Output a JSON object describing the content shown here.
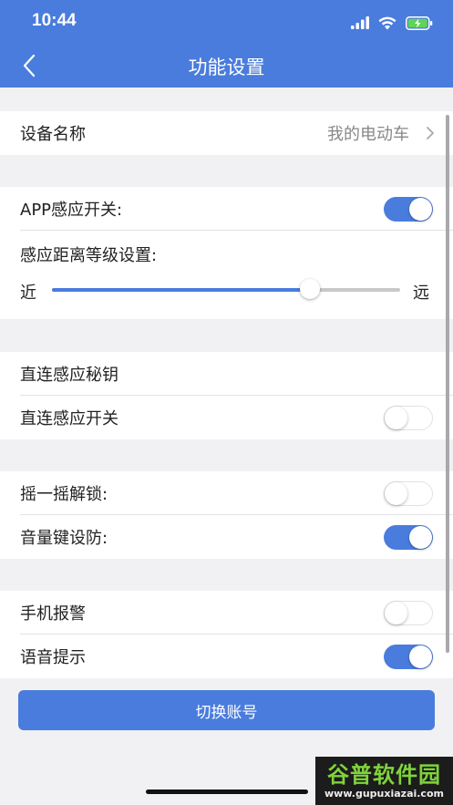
{
  "status": {
    "time": "10:44"
  },
  "header": {
    "title": "功能设置"
  },
  "device": {
    "label": "设备名称",
    "value": "我的电动车"
  },
  "sensing": {
    "app_switch_label": "APP感应开关:",
    "app_switch_on": true,
    "distance_label": "感应距离等级设置:",
    "slider_min_label": "近",
    "slider_max_label": "远",
    "slider_value_fraction": 0.74
  },
  "direct": {
    "key_label": "直连感应秘钥",
    "switch_label": "直连感应开关",
    "switch_on": false
  },
  "controls": {
    "shake_label": "摇一摇解锁:",
    "shake_on": false,
    "volume_label": "音量键设防:",
    "volume_on": true
  },
  "alerts": {
    "alarm_label": "手机报警",
    "alarm_on": false,
    "voice_label": "语音提示",
    "voice_on": true
  },
  "switch_account_label": "切换账号",
  "watermark": {
    "main": "谷普软件园",
    "url": "www.gupuxiazai.com"
  },
  "colors": {
    "accent": "#4a7cdd",
    "background": "#f1f1f3"
  }
}
